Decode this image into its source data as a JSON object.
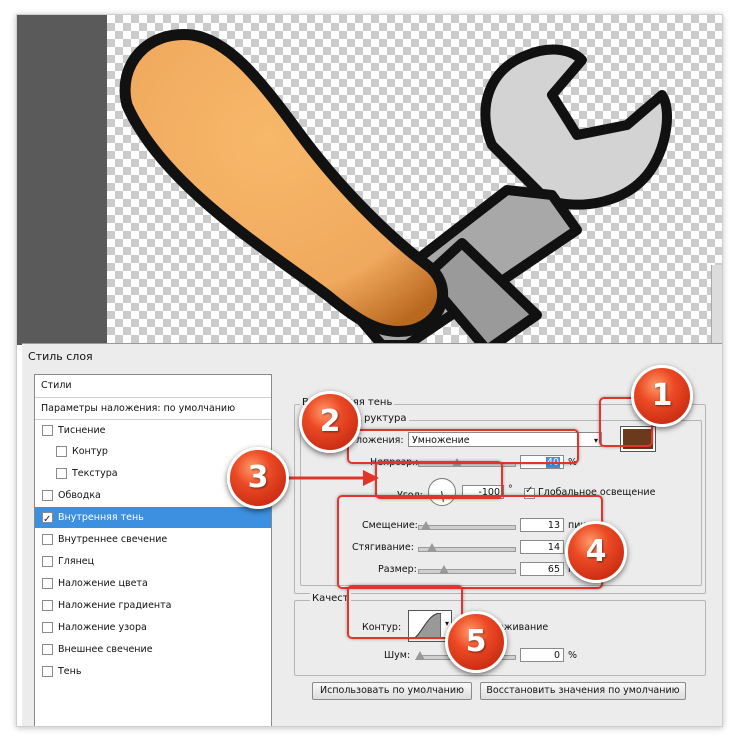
{
  "dialog": {
    "title": "Стиль слоя",
    "styles": [
      {
        "label": "Стили",
        "checkbox": false,
        "checked": false,
        "indent": 0,
        "selected": false
      },
      {
        "label": "Параметры наложения: по умолчанию",
        "checkbox": false,
        "checked": false,
        "indent": 0,
        "selected": false
      },
      {
        "label": "Тиснение",
        "checkbox": true,
        "checked": false,
        "indent": 0,
        "selected": false
      },
      {
        "label": "Контур",
        "checkbox": true,
        "checked": false,
        "indent": 1,
        "selected": false
      },
      {
        "label": "Текстура",
        "checkbox": true,
        "checked": false,
        "indent": 1,
        "selected": false
      },
      {
        "label": "Обводка",
        "checkbox": true,
        "checked": false,
        "indent": 0,
        "selected": false
      },
      {
        "label": "Внутренняя тень",
        "checkbox": true,
        "checked": true,
        "indent": 0,
        "selected": true
      },
      {
        "label": "Внутреннее свечение",
        "checkbox": true,
        "checked": false,
        "indent": 0,
        "selected": false
      },
      {
        "label": "Глянец",
        "checkbox": true,
        "checked": false,
        "indent": 0,
        "selected": false
      },
      {
        "label": "Наложение цвета",
        "checkbox": true,
        "checked": false,
        "indent": 0,
        "selected": false
      },
      {
        "label": "Наложение градиента",
        "checkbox": true,
        "checked": false,
        "indent": 0,
        "selected": false
      },
      {
        "label": "Наложение узора",
        "checkbox": true,
        "checked": false,
        "indent": 0,
        "selected": false
      },
      {
        "label": "Внешнее свечение",
        "checkbox": true,
        "checked": false,
        "indent": 0,
        "selected": false
      },
      {
        "label": "Тень",
        "checkbox": true,
        "checked": false,
        "indent": 0,
        "selected": false
      }
    ],
    "panel": {
      "section_title": "Внутренняя тень",
      "structure_label": "руктура",
      "blend_mode_label": "ложения:",
      "blend_mode_value": "Умножение",
      "shadow_color": "#6b3a1c",
      "opacity_label": "Непрозр.:",
      "opacity_value": "40",
      "opacity_unit": "%",
      "opacity_level": 0.4,
      "angle_label": "Угол:",
      "angle_value": "-100",
      "angle_unit": "°",
      "global_light_label": "Глобальное освещение",
      "global_light_checked": true,
      "distance_label": "Смещение:",
      "distance_value": "13",
      "distance_unit": "пикс.",
      "choke_label": "Стягивание:",
      "choke_value": "14",
      "choke_unit": "%",
      "size_label": "Размер:",
      "size_value": "65",
      "size_unit": "п",
      "quality_label": "Качест",
      "contour_label": "Контур:",
      "antialias_label": "лаживание",
      "noise_label": "Шум:",
      "noise_value": "0",
      "noise_unit": "%",
      "btn_default": "Использовать по умолчанию",
      "btn_reset": "Восстановить значения по умолчанию"
    }
  },
  "badges": [
    "1",
    "2",
    "3",
    "4",
    "5"
  ],
  "colors": {
    "accent_red": "#e3342c",
    "selection_blue": "#3d8fe0",
    "handle_orange": "#f0a95e"
  }
}
